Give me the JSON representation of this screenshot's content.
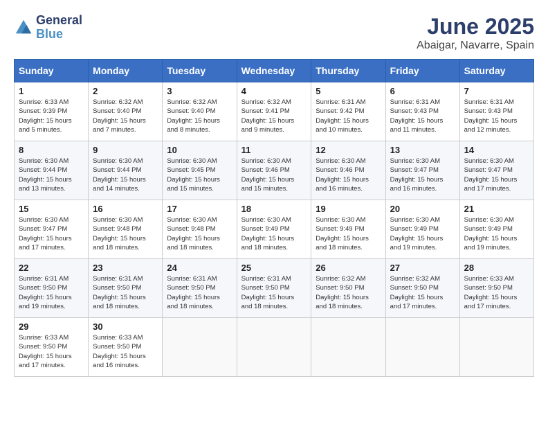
{
  "header": {
    "logo_general": "General",
    "logo_blue": "Blue",
    "title": "June 2025",
    "subtitle": "Abaigar, Navarre, Spain"
  },
  "calendar": {
    "headers": [
      "Sunday",
      "Monday",
      "Tuesday",
      "Wednesday",
      "Thursday",
      "Friday",
      "Saturday"
    ],
    "weeks": [
      [
        {
          "day": "1",
          "sunrise": "6:33 AM",
          "sunset": "9:39 PM",
          "daylight": "15 hours and 5 minutes."
        },
        {
          "day": "2",
          "sunrise": "6:32 AM",
          "sunset": "9:40 PM",
          "daylight": "15 hours and 7 minutes."
        },
        {
          "day": "3",
          "sunrise": "6:32 AM",
          "sunset": "9:40 PM",
          "daylight": "15 hours and 8 minutes."
        },
        {
          "day": "4",
          "sunrise": "6:32 AM",
          "sunset": "9:41 PM",
          "daylight": "15 hours and 9 minutes."
        },
        {
          "day": "5",
          "sunrise": "6:31 AM",
          "sunset": "9:42 PM",
          "daylight": "15 hours and 10 minutes."
        },
        {
          "day": "6",
          "sunrise": "6:31 AM",
          "sunset": "9:43 PM",
          "daylight": "15 hours and 11 minutes."
        },
        {
          "day": "7",
          "sunrise": "6:31 AM",
          "sunset": "9:43 PM",
          "daylight": "15 hours and 12 minutes."
        }
      ],
      [
        {
          "day": "8",
          "sunrise": "6:30 AM",
          "sunset": "9:44 PM",
          "daylight": "15 hours and 13 minutes."
        },
        {
          "day": "9",
          "sunrise": "6:30 AM",
          "sunset": "9:44 PM",
          "daylight": "15 hours and 14 minutes."
        },
        {
          "day": "10",
          "sunrise": "6:30 AM",
          "sunset": "9:45 PM",
          "daylight": "15 hours and 15 minutes."
        },
        {
          "day": "11",
          "sunrise": "6:30 AM",
          "sunset": "9:46 PM",
          "daylight": "15 hours and 15 minutes."
        },
        {
          "day": "12",
          "sunrise": "6:30 AM",
          "sunset": "9:46 PM",
          "daylight": "15 hours and 16 minutes."
        },
        {
          "day": "13",
          "sunrise": "6:30 AM",
          "sunset": "9:47 PM",
          "daylight": "15 hours and 16 minutes."
        },
        {
          "day": "14",
          "sunrise": "6:30 AM",
          "sunset": "9:47 PM",
          "daylight": "15 hours and 17 minutes."
        }
      ],
      [
        {
          "day": "15",
          "sunrise": "6:30 AM",
          "sunset": "9:47 PM",
          "daylight": "15 hours and 17 minutes."
        },
        {
          "day": "16",
          "sunrise": "6:30 AM",
          "sunset": "9:48 PM",
          "daylight": "15 hours and 18 minutes."
        },
        {
          "day": "17",
          "sunrise": "6:30 AM",
          "sunset": "9:48 PM",
          "daylight": "15 hours and 18 minutes."
        },
        {
          "day": "18",
          "sunrise": "6:30 AM",
          "sunset": "9:49 PM",
          "daylight": "15 hours and 18 minutes."
        },
        {
          "day": "19",
          "sunrise": "6:30 AM",
          "sunset": "9:49 PM",
          "daylight": "15 hours and 18 minutes."
        },
        {
          "day": "20",
          "sunrise": "6:30 AM",
          "sunset": "9:49 PM",
          "daylight": "15 hours and 19 minutes."
        },
        {
          "day": "21",
          "sunrise": "6:30 AM",
          "sunset": "9:49 PM",
          "daylight": "15 hours and 19 minutes."
        }
      ],
      [
        {
          "day": "22",
          "sunrise": "6:31 AM",
          "sunset": "9:50 PM",
          "daylight": "15 hours and 19 minutes."
        },
        {
          "day": "23",
          "sunrise": "6:31 AM",
          "sunset": "9:50 PM",
          "daylight": "15 hours and 18 minutes."
        },
        {
          "day": "24",
          "sunrise": "6:31 AM",
          "sunset": "9:50 PM",
          "daylight": "15 hours and 18 minutes."
        },
        {
          "day": "25",
          "sunrise": "6:31 AM",
          "sunset": "9:50 PM",
          "daylight": "15 hours and 18 minutes."
        },
        {
          "day": "26",
          "sunrise": "6:32 AM",
          "sunset": "9:50 PM",
          "daylight": "15 hours and 18 minutes."
        },
        {
          "day": "27",
          "sunrise": "6:32 AM",
          "sunset": "9:50 PM",
          "daylight": "15 hours and 17 minutes."
        },
        {
          "day": "28",
          "sunrise": "6:33 AM",
          "sunset": "9:50 PM",
          "daylight": "15 hours and 17 minutes."
        }
      ],
      [
        {
          "day": "29",
          "sunrise": "6:33 AM",
          "sunset": "9:50 PM",
          "daylight": "15 hours and 17 minutes."
        },
        {
          "day": "30",
          "sunrise": "6:33 AM",
          "sunset": "9:50 PM",
          "daylight": "15 hours and 16 minutes."
        },
        null,
        null,
        null,
        null,
        null
      ]
    ]
  }
}
